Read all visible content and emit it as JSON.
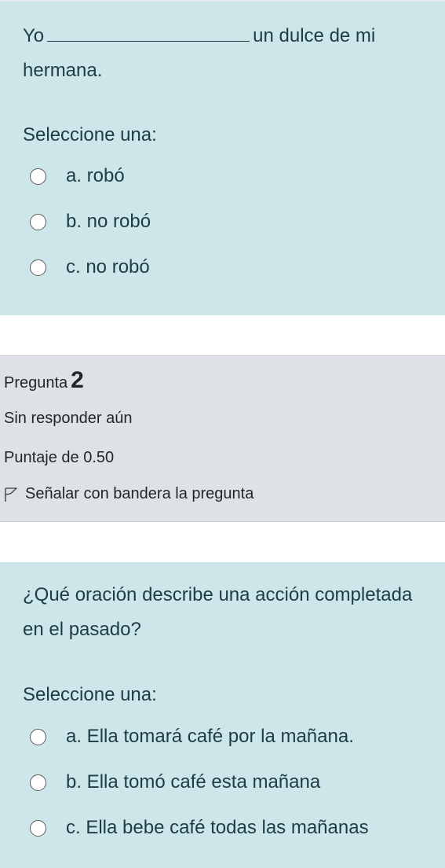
{
  "question1": {
    "text_before_blank": "Yo",
    "text_after_blank": "un dulce de mi hermana.",
    "select_label": "Seleccione una:",
    "options": [
      {
        "label": "a. robó"
      },
      {
        "label": "b. no robó"
      },
      {
        "label": "c. no robó"
      }
    ]
  },
  "question2_info": {
    "prefix": "Pregunta",
    "number": "2",
    "status": "Sin responder aún",
    "score": "Puntaje de 0.50",
    "flag_label": "Señalar con bandera la pregunta",
    "flag_icon": "flag-outline-icon"
  },
  "question2": {
    "text": "¿Qué oración describe una acción completada en el pasado?",
    "select_label": "Seleccione una:",
    "options": [
      {
        "label": "a. Ella tomará café por la mañana."
      },
      {
        "label": "b. Ella tomó café esta mañana"
      },
      {
        "label": "c. Ella bebe café todas las mañanas"
      }
    ]
  }
}
